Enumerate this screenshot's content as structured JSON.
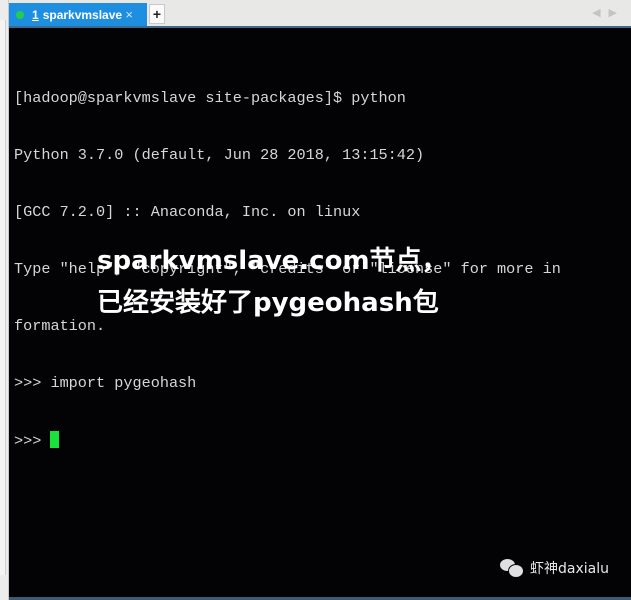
{
  "tabbar": {
    "active_tab": {
      "number": "1",
      "label": "sparkvmslave",
      "status_color": "#1fd04a",
      "close_glyph": "×"
    },
    "add_tab_glyph": "+",
    "nav_prev_glyph": "◀",
    "nav_next_glyph": "▶"
  },
  "terminal": {
    "lines": [
      "[hadoop@sparkvmslave site-packages]$ python",
      "Python 3.7.0 (default, Jun 28 2018, 13:15:42)",
      "[GCC 7.2.0] :: Anaconda, Inc. on linux",
      "Type \"help\", \"copyright\", \"credits\" or \"license\" for more in",
      "formation.",
      ">>> import pygeohash"
    ],
    "prompt": ">>> ",
    "cursor_color": "#19e33a"
  },
  "overlay": {
    "line1": "sparkvmslave.com节点，",
    "line2": "已经安装好了pygeohash包"
  },
  "watermark": {
    "icon": "wechat-icon",
    "text": "虾神daxialu"
  }
}
